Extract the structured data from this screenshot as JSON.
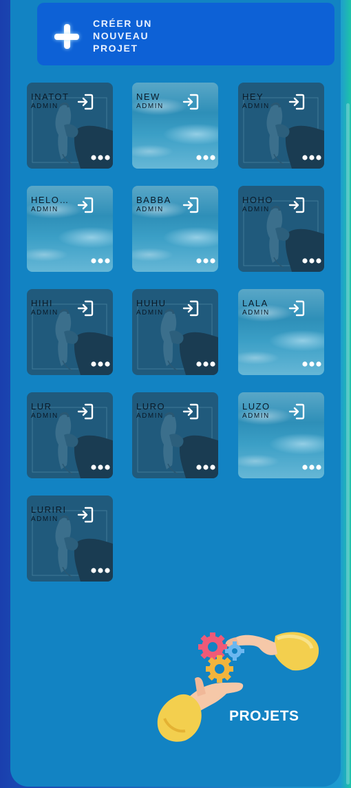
{
  "create_button": {
    "label": "CRÉER UN NOUVEAU PROJET"
  },
  "projects": [
    {
      "name": "INATOT",
      "role": "ADMIN",
      "thumb": "phone"
    },
    {
      "name": "NEW",
      "role": "ADMIN",
      "thumb": "ice"
    },
    {
      "name": "HEY",
      "role": "ADMIN",
      "thumb": "phone"
    },
    {
      "name": "HELO…",
      "role": "ADMIN",
      "thumb": "ice"
    },
    {
      "name": "BABBA",
      "role": "ADMIN",
      "thumb": "ice"
    },
    {
      "name": "HOHO",
      "role": "ADMIN",
      "thumb": "phone"
    },
    {
      "name": "HIHI",
      "role": "ADMIN",
      "thumb": "phone"
    },
    {
      "name": "HUHU",
      "role": "ADMIN",
      "thumb": "phone"
    },
    {
      "name": "LALA",
      "role": "ADMIN",
      "thumb": "ice"
    },
    {
      "name": "LUR",
      "role": "ADMIN",
      "thumb": "phone"
    },
    {
      "name": "LURO",
      "role": "ADMIN",
      "thumb": "phone"
    },
    {
      "name": "LUZO",
      "role": "ADMIN",
      "thumb": "ice"
    },
    {
      "name": "LURIRI",
      "role": "ADMIN",
      "thumb": "phone"
    }
  ],
  "icons": {
    "create": "plus-icon",
    "open": "enter-icon",
    "menu": "more-options-icon"
  },
  "footer": {
    "title": "PROJETS"
  },
  "colors": {
    "panel": "#1283c3",
    "button": "#0d61d6",
    "card_dark": "#205a7c"
  }
}
